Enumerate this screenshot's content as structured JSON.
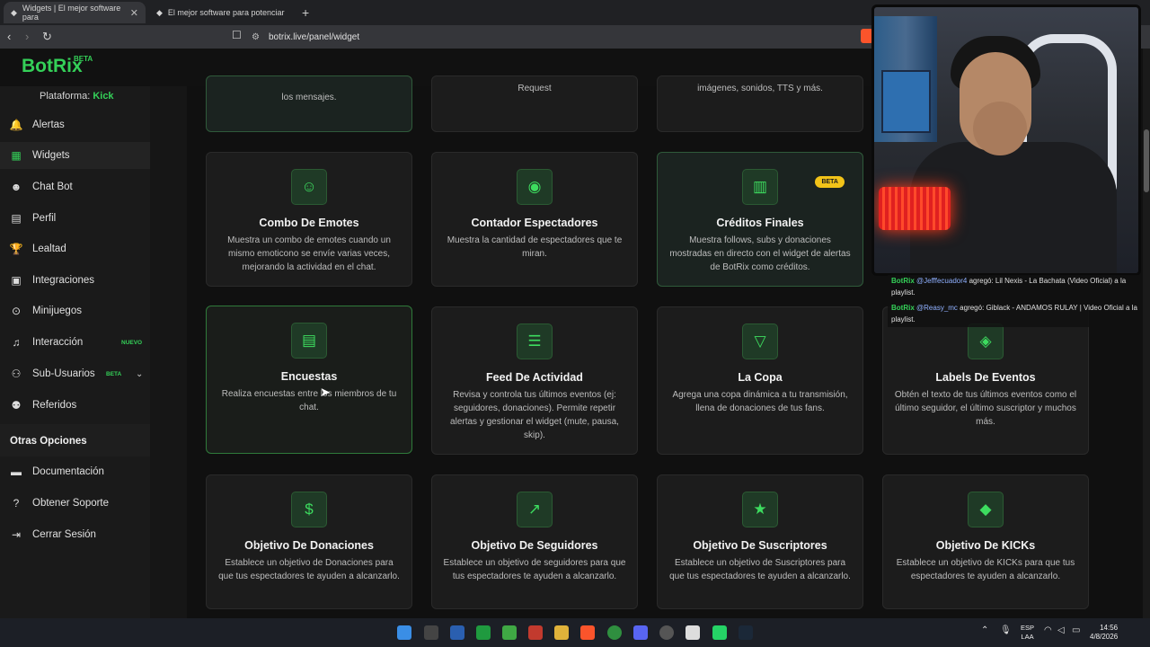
{
  "browser": {
    "tabs": [
      {
        "label": "Widgets | El mejor software para"
      },
      {
        "label": "El mejor software para potenciar"
      }
    ],
    "new_tab": "+",
    "url": "botrix.live/panel/widget"
  },
  "app": {
    "logo": "BotRix",
    "logo_badge": "BETA",
    "platform_label": "Plataforma:",
    "platform_value": "Kick"
  },
  "sidebar": {
    "items": [
      {
        "label": "Alertas",
        "icon": "bell-icon"
      },
      {
        "label": "Widgets",
        "icon": "grid-icon"
      },
      {
        "label": "Chat Bot",
        "icon": "robot-icon"
      },
      {
        "label": "Perfil",
        "icon": "id-card-icon"
      },
      {
        "label": "Lealtad",
        "icon": "trophy-icon"
      },
      {
        "label": "Integraciones",
        "icon": "plug-icon"
      },
      {
        "label": "Minijuegos",
        "icon": "gamepad-icon"
      },
      {
        "label": "Interacción",
        "icon": "music-icon",
        "badge": "NUEVO"
      },
      {
        "label": "Sub-Usuarios",
        "icon": "users-icon",
        "badge": "BETA"
      },
      {
        "label": "Referidos",
        "icon": "people-icon"
      }
    ],
    "section_title": "Otras Opciones",
    "other_items": [
      {
        "label": "Documentación",
        "icon": "book-icon"
      },
      {
        "label": "Obtener Soporte",
        "icon": "help-icon"
      },
      {
        "label": "Cerrar Sesión",
        "icon": "logout-icon"
      }
    ],
    "active": "Widgets",
    "badge_colors": {
      "nuevo": "#34d058",
      "beta": "#34d058"
    }
  },
  "partial_cards": [
    {
      "desc": "los mensajes."
    },
    {
      "desc": "Request"
    },
    {
      "desc": "imágenes, sonidos, TTS y más."
    }
  ],
  "cards": [
    {
      "title": "Combo De Emotes",
      "desc": "Muestra un combo de emotes cuando un mismo emoticono se envíe varias veces, mejorando la actividad en el chat.",
      "icon": "smile-icon"
    },
    {
      "title": "Contador Espectadores",
      "desc": "Muestra la cantidad de espectadores que te miran.",
      "icon": "eye-icon"
    },
    {
      "title": "Créditos Finales",
      "desc": "Muestra follows, subs y donaciones mostradas en directo con el widget de alertas de BotRix como créditos.",
      "icon": "film-icon",
      "badge": "BETA"
    },
    {
      "title": "Encuestas",
      "desc": "Realiza encuestas entre los miembros de tu chat.",
      "icon": "poll-icon"
    },
    {
      "title": "Feed De Actividad",
      "desc": "Revisa y controla tus últimos eventos (ej: seguidores, donaciones). Permite repetir alertas y gestionar el widget (mute, pausa, skip).",
      "icon": "list-icon"
    },
    {
      "title": "La Copa",
      "desc": "Agrega una copa dinámica a tu transmisión, llena de donaciones de tus fans.",
      "icon": "cocktail-icon"
    },
    {
      "title": "Labels De Eventos",
      "desc": "Obtén el texto de tus últimos eventos como el último seguidor, el último suscriptor y muchos más.",
      "icon": "tags-icon"
    },
    {
      "title": "Objetivo De Donaciones",
      "desc": "Establece un objetivo de Donaciones para que tus espectadores te ayuden a alcanzarlo.",
      "icon": "dollar-icon"
    },
    {
      "title": "Objetivo De Seguidores",
      "desc": "Establece un objetivo de seguidores para que tus espectadores te ayuden a alcanzarlo.",
      "icon": "chart-line-icon"
    },
    {
      "title": "Objetivo De Suscriptores",
      "desc": "Establece un objetivo de Suscriptores para que tus espectadores te ayuden a alcanzarlo.",
      "icon": "star-icon"
    },
    {
      "title": "Objetivo De KICKs",
      "desc": "Establece un objetivo de KICKs para que tus espectadores te ayuden a alcanzarlo.",
      "icon": "gem-icon"
    }
  ],
  "chat_overlay": {
    "messages": [
      {
        "bot": "BotRix",
        "user": "@Jefffecuador4",
        "text": "agregó: Lil Nexis - La Bachata (Video Oficial) a la playlist."
      },
      {
        "bot": "BotRix",
        "user": "@Reasy_mc",
        "text": "agregó: Giblack - ANDAMOS RULAY | Video Oficial a la playlist."
      }
    ]
  },
  "taskbar": {
    "lang_top": "ESP",
    "lang_bottom": "LAA",
    "time": "14:56",
    "date": "4/8/2026"
  },
  "colors": {
    "accent": "#34d058",
    "beta_pill": "#f2c318"
  }
}
